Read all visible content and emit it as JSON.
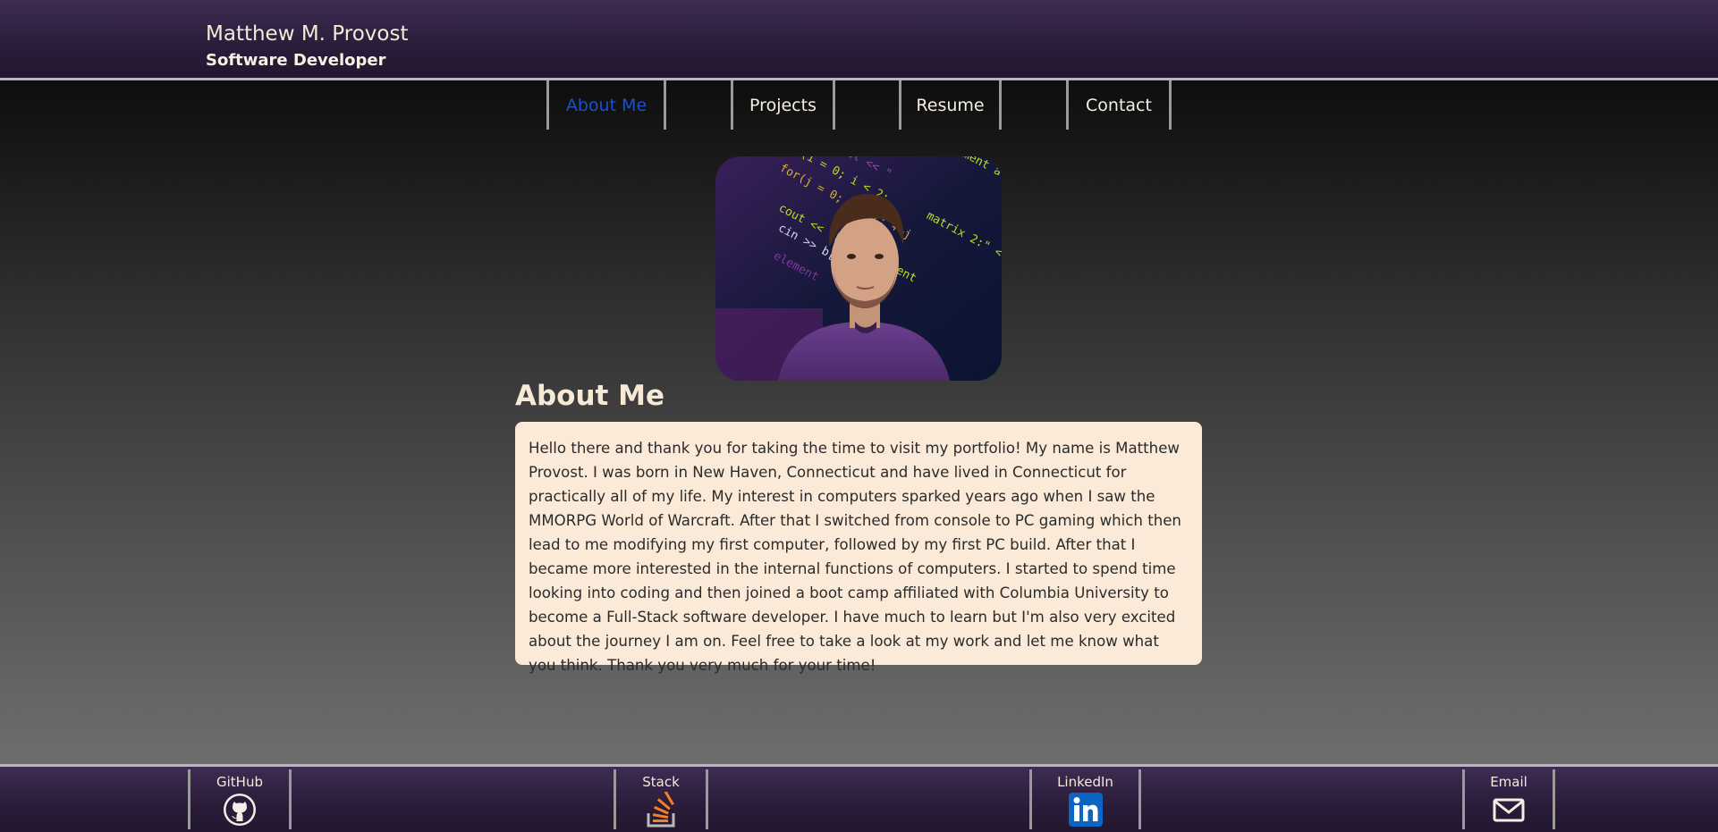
{
  "header": {
    "name": "Matthew M. Provost",
    "title": "Software Developer"
  },
  "nav": {
    "items": [
      {
        "label": "About Me",
        "active": true
      },
      {
        "label": "Projects",
        "active": false
      },
      {
        "label": "Resume",
        "active": false
      },
      {
        "label": "Contact",
        "active": false
      }
    ]
  },
  "main": {
    "avatar_alt": "profile-photo",
    "section_title": "About Me",
    "about_text": "Hello there and thank you for taking the time to visit my portfolio! My name is Matthew Provost. I was born in New Haven, Connecticut and have lived in Connecticut for practically all of my life. My interest in computers sparked years ago when I saw the MMORPG World of Warcraft. After that I switched from console to PC gaming which then lead to me modifying my first computer, followed by my first PC build. After that I became more interested in the internal functions of computers. I started to spend time looking into coding and then joined a boot camp affiliated with Columbia University to become a Full-Stack software developer. I have much to learn but I'm also very excited about the journey I am on. Feel free to take a look at my work and let me know what you think. Thank you very much for your time!"
  },
  "footer": {
    "links": [
      {
        "label": "GitHub",
        "icon": "github-icon"
      },
      {
        "label": "Stack",
        "icon": "stackoverflow-icon"
      },
      {
        "label": "LinkedIn",
        "icon": "linkedin-icon"
      },
      {
        "label": "Email",
        "icon": "email-icon"
      }
    ]
  },
  "colors": {
    "accent_purple": "#2a1c3a",
    "active_nav": "#1a4fd0",
    "card_bg": "#faead7",
    "heading": "#f6ead6"
  }
}
